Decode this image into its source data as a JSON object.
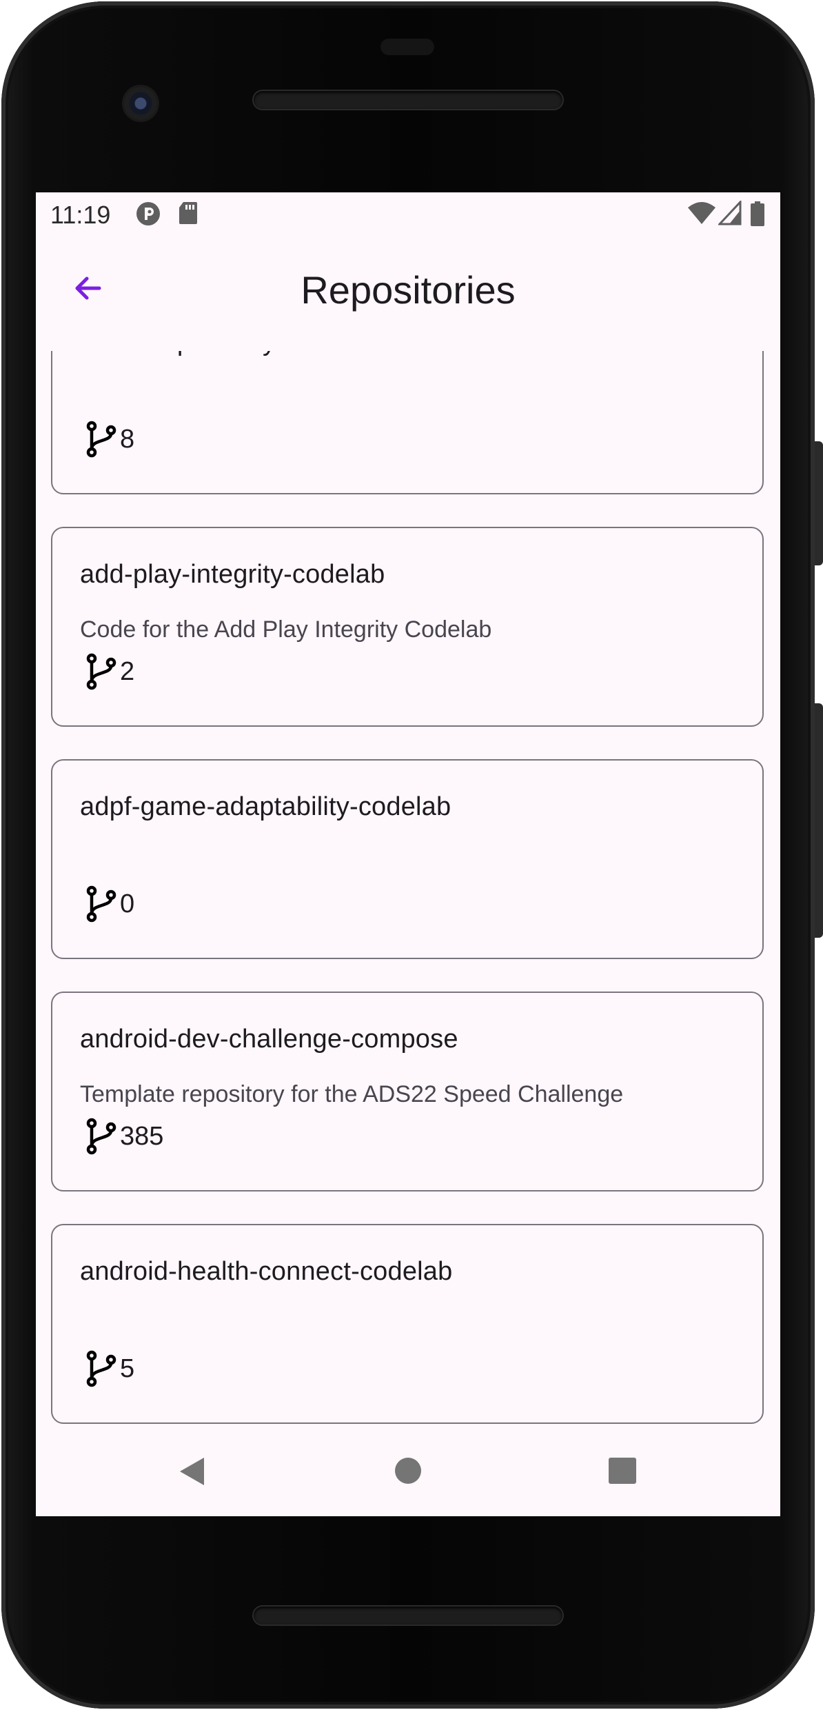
{
  "status_bar": {
    "time": "11:19"
  },
  "app_bar": {
    "title": "Repositories"
  },
  "repositories": [
    {
      "name": "add-adaptive-layouts",
      "description": "",
      "forks": "8"
    },
    {
      "name": "add-play-integrity-codelab",
      "description": "Code for the Add Play Integrity Codelab",
      "forks": "2"
    },
    {
      "name": "adpf-game-adaptability-codelab",
      "description": "",
      "forks": "0"
    },
    {
      "name": "android-dev-challenge-compose",
      "description": "Template repository for the ADS22 Speed Challenge",
      "forks": "385"
    },
    {
      "name": "android-health-connect-codelab",
      "description": "",
      "forks": "5"
    }
  ],
  "colors": {
    "accent": "#7b1fe0",
    "screen_background": "#fef7fb",
    "card_border": "#79747e",
    "text_primary": "#1d1b20",
    "text_secondary": "#49454f"
  },
  "icons": {
    "back": "arrow-back-icon",
    "fork": "fork-icon",
    "nav_back": "triangle-back-icon",
    "nav_home": "circle-home-icon",
    "nav_recents": "square-recents-icon"
  }
}
